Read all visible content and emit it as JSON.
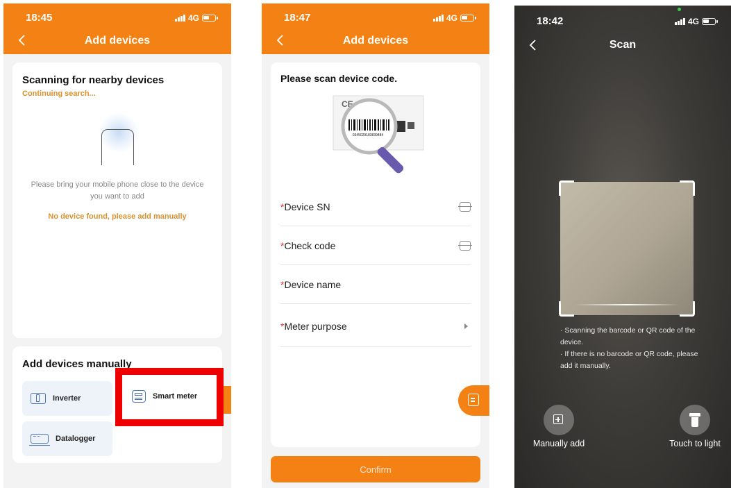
{
  "screen1": {
    "status_time": "18:45",
    "network": "4G",
    "title": "Add devices",
    "scanning_title": "Scanning for nearby devices",
    "scanning_subtitle": "Continuing search...",
    "hint": "Please bring your mobile phone close to the device you want to add",
    "no_device": "No device found, please add manually",
    "manual_title": "Add devices manually",
    "devices": [
      {
        "label": "Inverter",
        "icon": "inverter-icon"
      },
      {
        "label": "Smart meter",
        "icon": "smart-meter-icon"
      },
      {
        "label": "Datalogger",
        "icon": "datalogger-icon"
      }
    ],
    "highlight_color": "#ee0000"
  },
  "screen2": {
    "status_time": "18:47",
    "network": "4G",
    "title": "Add devices",
    "scan_prompt": "Please scan device code.",
    "label_serial": "0345029183839484",
    "fields": [
      {
        "required_mark": "*",
        "label": "Device SN",
        "trailing": "scan-icon"
      },
      {
        "required_mark": "*",
        "label": "Check code",
        "trailing": "scan-icon"
      },
      {
        "required_mark": "*",
        "label": "Device name",
        "trailing": ""
      },
      {
        "required_mark": "*",
        "label": "Meter purpose",
        "trailing": "arrow-right-icon"
      }
    ],
    "confirm_label": "Confirm"
  },
  "screen3": {
    "status_time": "18:42",
    "network": "4G",
    "title": "Scan",
    "tip1": "· Scanning the barcode or QR code of the device.",
    "tip2": "· If there is no barcode or QR code, please add it manually.",
    "manual_add_label": "Manually add",
    "light_label": "Touch to light"
  },
  "colors": {
    "accent": "#f48114",
    "link_orange": "#d9922c",
    "required": "#e53935",
    "device_tile_bg": "#eef2f9"
  }
}
